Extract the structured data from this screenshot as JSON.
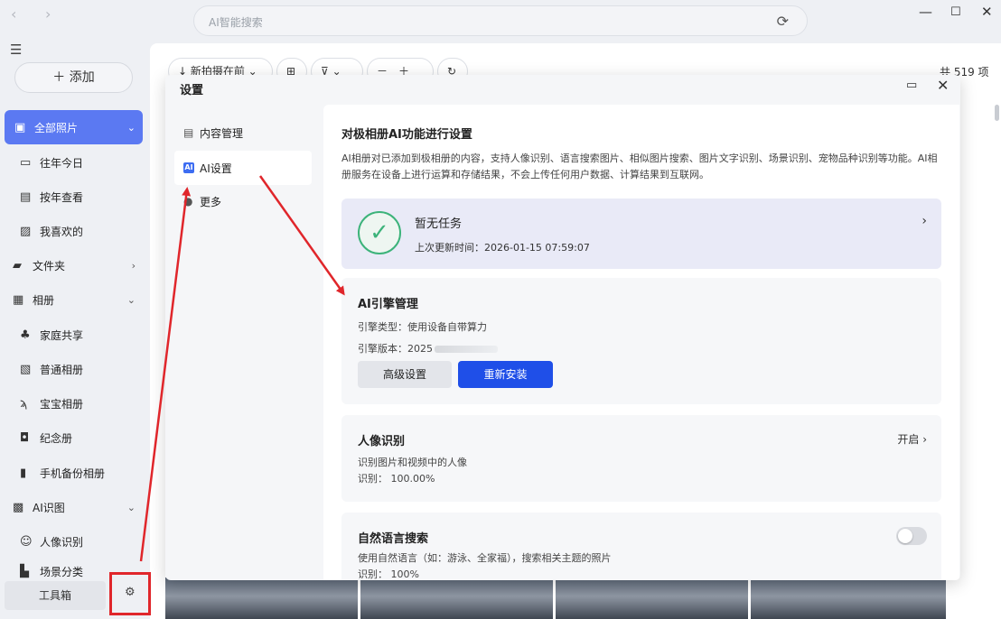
{
  "window": {
    "search_placeholder": "AI智能搜索",
    "controls": [
      "—",
      "☐",
      "✕"
    ]
  },
  "sidebar": {
    "add_label": "＋  添加",
    "items": [
      {
        "label": "全部照片",
        "icon": "photo-icon"
      },
      {
        "label": "往年今日",
        "icon": "calendar-icon"
      },
      {
        "label": "按年查看",
        "icon": "year-icon"
      },
      {
        "label": "我喜欢的",
        "icon": "favorite-icon"
      },
      {
        "label": "文件夹",
        "icon": "folder-icon"
      },
      {
        "label": "相册",
        "icon": "album-icon"
      },
      {
        "label": "家庭共享",
        "icon": "family-icon"
      },
      {
        "label": "普通相册",
        "icon": "album-normal-icon"
      },
      {
        "label": "宝宝相册",
        "icon": "baby-icon"
      },
      {
        "label": "纪念册",
        "icon": "memorial-icon"
      },
      {
        "label": "手机备份相册",
        "icon": "phone-icon"
      },
      {
        "label": "AI识图",
        "icon": "ai-image-icon"
      },
      {
        "label": "人像识别",
        "icon": "face-icon"
      },
      {
        "label": "场景分类",
        "icon": "scene-icon"
      }
    ],
    "toolbox_label": "工具箱"
  },
  "background": {
    "sort_label": "↓ 新拍摄在前 ⌄",
    "count_label": "共 519 项"
  },
  "dialog": {
    "title": "设置",
    "nav": [
      {
        "label": "内容管理"
      },
      {
        "label": "AI设置"
      },
      {
        "label": "更多"
      }
    ],
    "ai_badge": "AI",
    "content": {
      "title": "对极相册AI功能进行设置",
      "description": "AI相册对已添加到极相册的内容，支持人像识别、语言搜索图片、相似图片搜索、图片文字识别、场景识别、宠物品种识别等功能。AI相册服务在设备上进行运算和存储结果，不会上传任何用户数据、计算结果到互联网。",
      "status": {
        "title": "暂无任务",
        "last_update": "上次更新时间：2026-01-15 07:59:07"
      },
      "engine": {
        "title": "AI引擎管理",
        "type": "引擎类型：使用设备自带算力",
        "version": "引擎版本：2025",
        "advanced_btn": "高级设置",
        "reinstall_btn": "重新安装"
      },
      "face": {
        "title": "人像识别",
        "desc": "识别图片和视频中的人像",
        "rate": "识别：  100.00%",
        "state": "开启"
      },
      "nl_search": {
        "title": "自然语言搜索",
        "desc": "使用自然语言（如：游泳、全家福），搜索相关主题的照片",
        "rate": "识别：  100%",
        "enabled": false
      }
    }
  },
  "colors": {
    "accent": "#5b79f2",
    "primary_button": "#1f4fe8",
    "annotation_red": "#e0262b",
    "success": "#3cb37a"
  }
}
